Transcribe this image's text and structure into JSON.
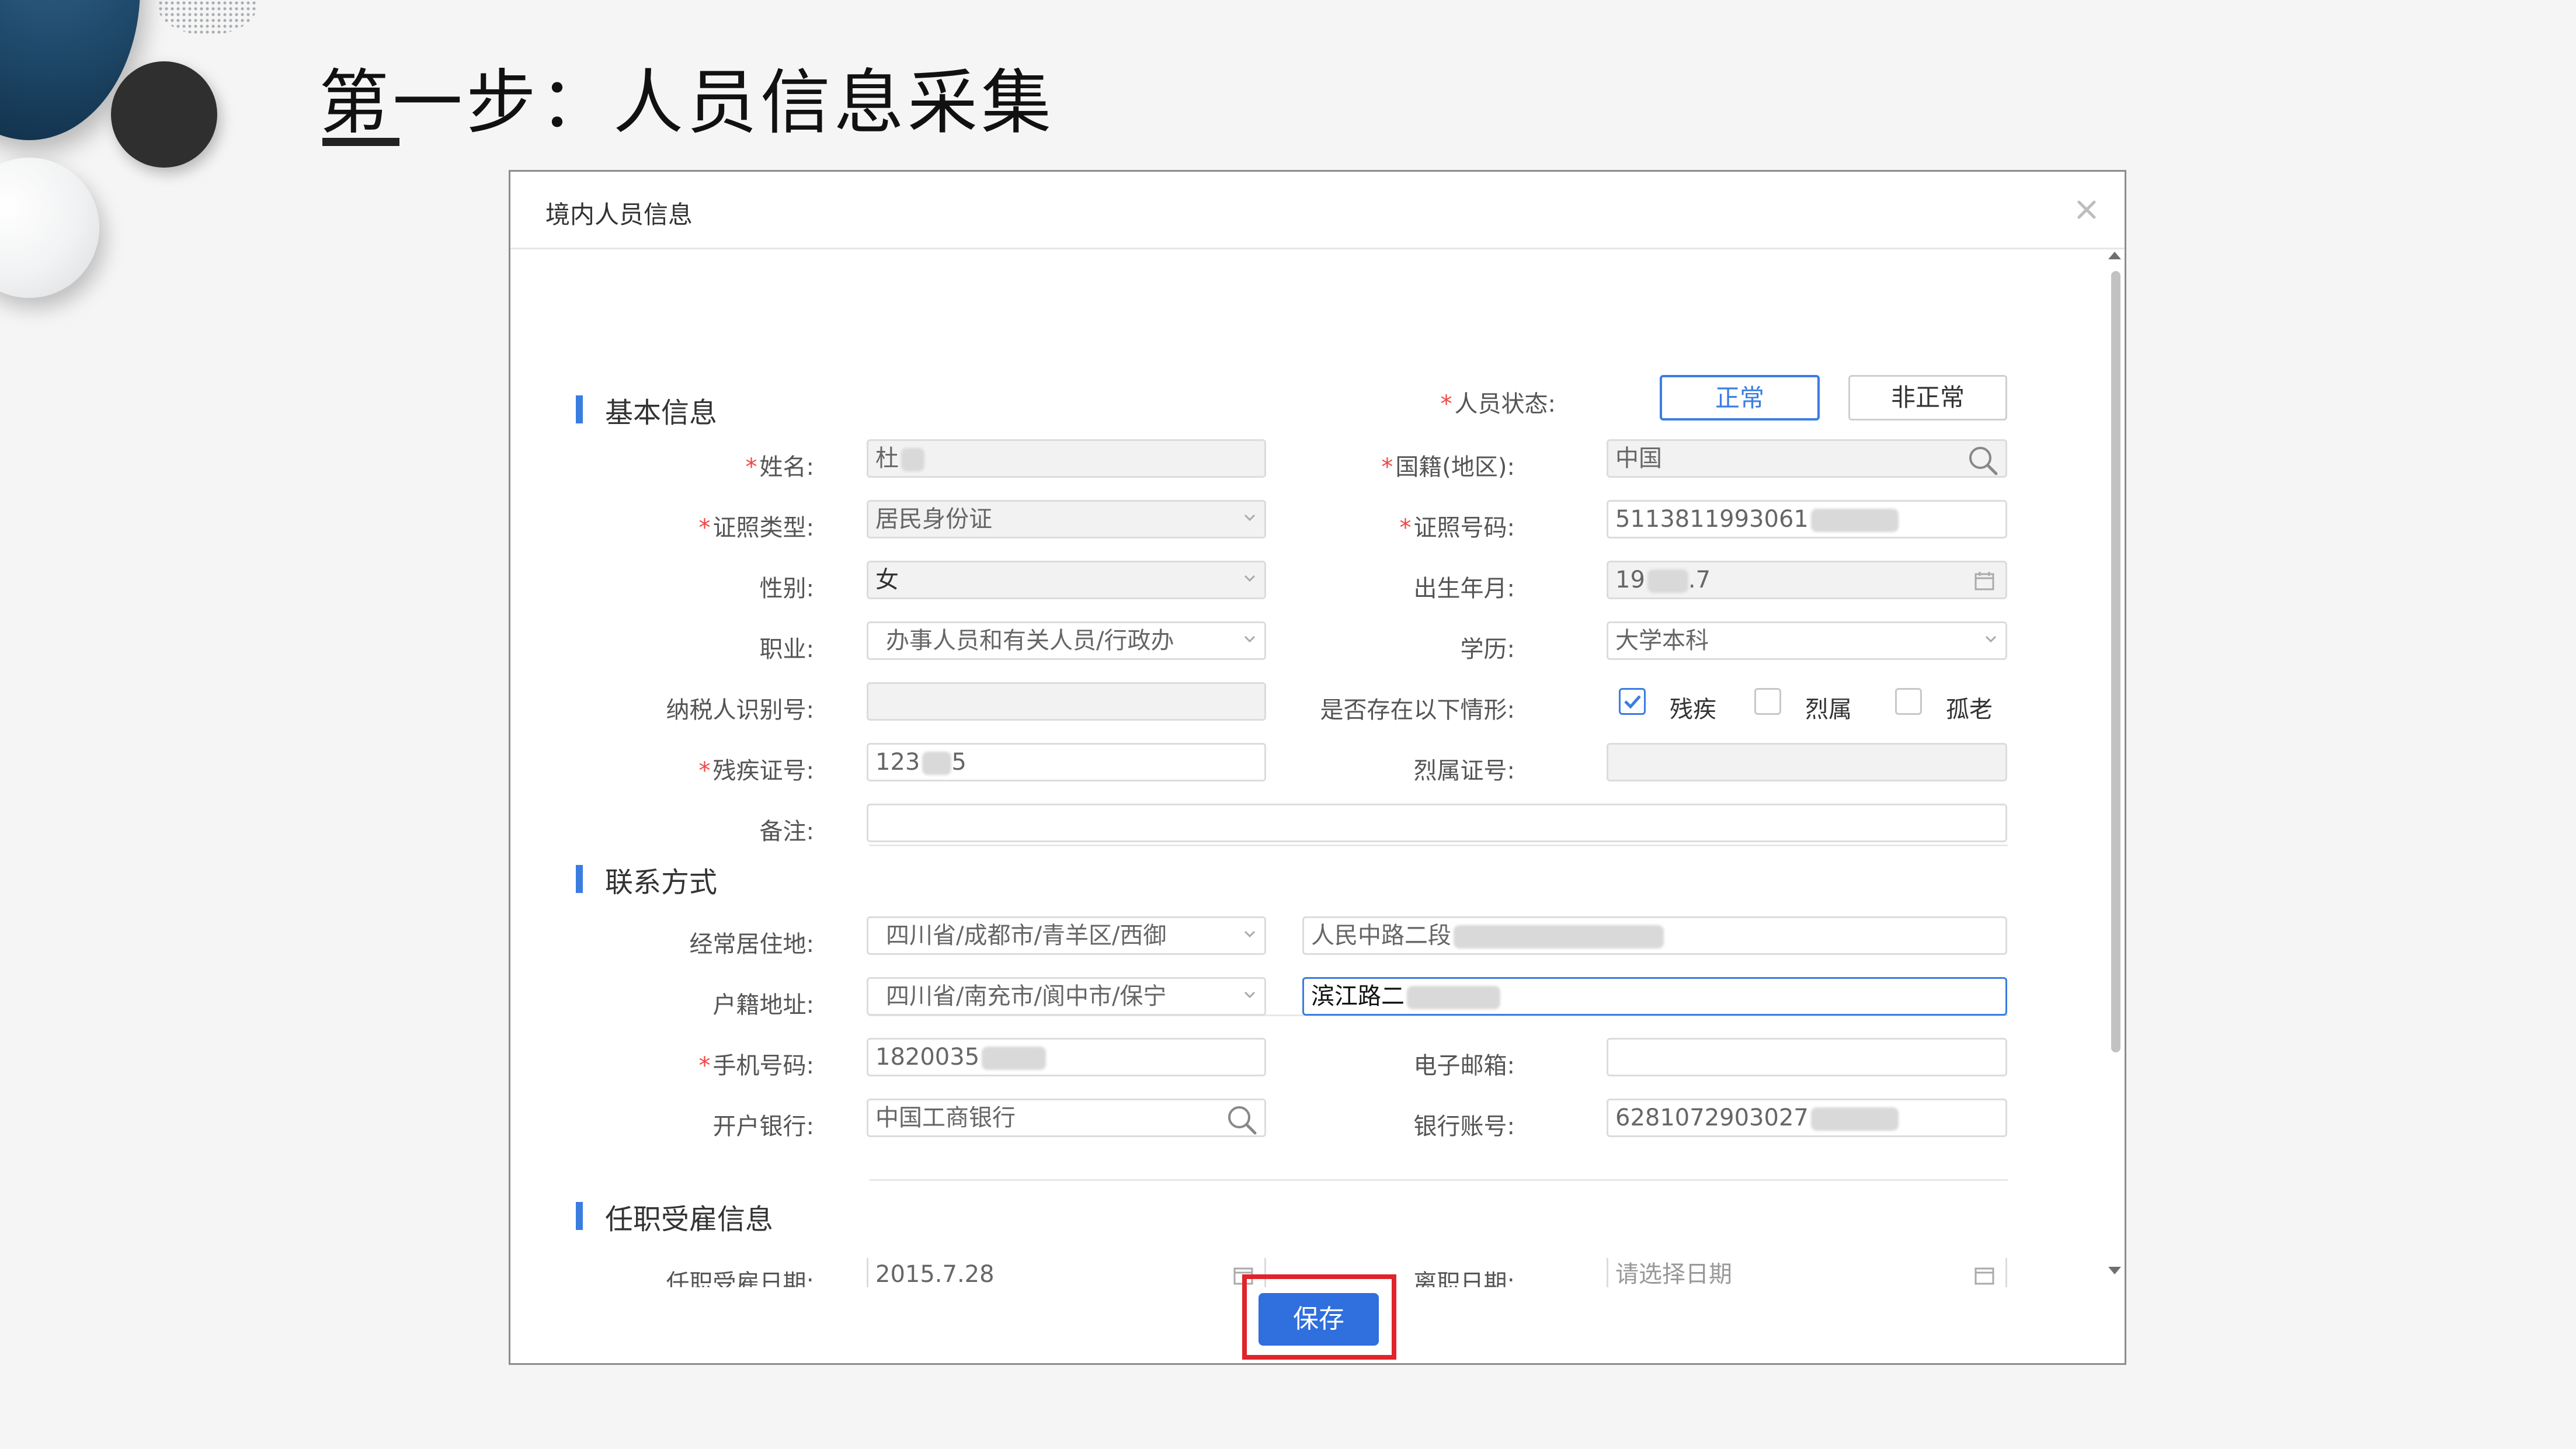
{
  "slide": {
    "title": "第一步：人员信息采集"
  },
  "dialog": {
    "title": "境内人员信息"
  },
  "status": {
    "label": "人员状态:",
    "normal": "正常",
    "abnormal": "非正常"
  },
  "sections": {
    "basic": "基本信息",
    "contact": "联系方式",
    "employment": "任职受雇信息"
  },
  "basic": {
    "name_label": "姓名:",
    "name_value": "杜",
    "nationality_label": "国籍(地区):",
    "nationality_value": "中国",
    "id_type_label": "证照类型:",
    "id_type_value": "居民身份证",
    "id_number_label": "证照号码:",
    "id_number_value": "5113811993061",
    "gender_label": "性别:",
    "gender_value": "女",
    "birth_label": "出生年月:",
    "birth_value_a": "19",
    "birth_value_b": ".7",
    "occupation_label": "职业:",
    "occupation_value": "办事人员和有关人员/行政办",
    "education_label": "学历:",
    "education_value": "大学本科",
    "taxpayer_label": "纳税人识别号:",
    "situation_label": "是否存在以下情形:",
    "opt_disabled": "残疾",
    "opt_martyr": "烈属",
    "opt_elderly": "孤老",
    "disability_no_label": "残疾证号:",
    "disability_no_value_a": "123",
    "disability_no_value_b": "5",
    "martyr_no_label": "烈属证号:",
    "remark_label": "备注:"
  },
  "contact": {
    "residence_label": "经常居住地:",
    "residence_region": "四川省/成都市/青羊区/西御",
    "residence_detail": "人民中路二段",
    "hukou_label": "户籍地址:",
    "hukou_region": "四川省/南充市/阆中市/保宁",
    "hukou_detail": "滨江路二",
    "phone_label": "手机号码:",
    "phone_value": "1820035",
    "email_label": "电子邮箱:",
    "bank_label": "开户银行:",
    "bank_value": "中国工商银行",
    "account_label": "银行账号:",
    "account_value": "6281072903027"
  },
  "employment": {
    "hire_date_label": "任职受雇日期:",
    "hire_date_value": "2015.7.28",
    "leave_date_label": "离职日期:",
    "leave_date_placeholder": "请选择日期"
  },
  "actions": {
    "save": "保存"
  },
  "colors": {
    "accent": "#3a7de0",
    "required": "#f04747",
    "highlight": "#e0242b"
  }
}
